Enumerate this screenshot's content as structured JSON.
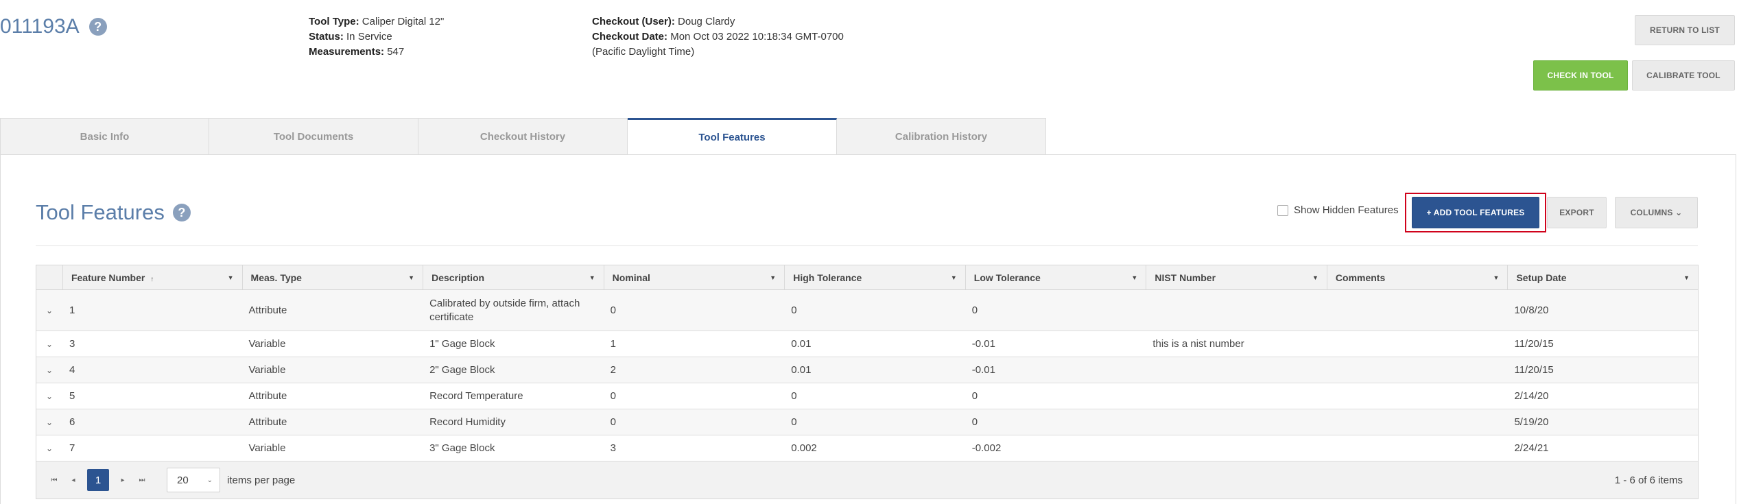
{
  "header": {
    "tool_id": "011193A",
    "help_icon": "?",
    "tool_type_label": "Tool Type:",
    "tool_type": "Caliper Digital 12\"",
    "status_label": "Status:",
    "status": "In Service",
    "measurements_label": "Measurements:",
    "measurements": "547",
    "checkout_user_label": "Checkout (User):",
    "checkout_user": "Doug Clardy",
    "checkout_date_label": "Checkout Date:",
    "checkout_date": "Mon Oct 03 2022 10:18:34 GMT-0700",
    "checkout_tz": "(Pacific Daylight Time)"
  },
  "actions": {
    "return_to_list": "RETURN TO LIST",
    "check_in_tool": "CHECK IN TOOL",
    "calibrate_tool": "CALIBRATE TOOL"
  },
  "tabs": [
    {
      "label": "Basic Info"
    },
    {
      "label": "Tool Documents"
    },
    {
      "label": "Checkout History"
    },
    {
      "label": "Tool Features"
    },
    {
      "label": "Calibration History"
    }
  ],
  "section": {
    "title": "Tool Features",
    "help_icon": "?",
    "show_hidden_label": "Show Hidden Features",
    "add_button": "+ ADD TOOL FEATURES",
    "export_button": "EXPORT",
    "columns_button": "COLUMNS ⌄"
  },
  "grid": {
    "headers": [
      "Feature Number",
      "Meas. Type",
      "Description",
      "Nominal",
      "High Tolerance",
      "Low Tolerance",
      "NIST Number",
      "Comments",
      "Setup Date"
    ],
    "sort_indicator": "↑",
    "rows": [
      [
        "1",
        "Attribute",
        "Calibrated by outside firm, attach certificate",
        "0",
        "0",
        "0",
        "",
        "",
        "10/8/20"
      ],
      [
        "3",
        "Variable",
        "1\" Gage Block",
        "1",
        "0.01",
        "-0.01",
        "this is a nist number",
        "",
        "11/20/15"
      ],
      [
        "4",
        "Variable",
        "2\" Gage Block",
        "2",
        "0.01",
        "-0.01",
        "",
        "",
        "11/20/15"
      ],
      [
        "5",
        "Attribute",
        "Record Temperature",
        "0",
        "0",
        "0",
        "",
        "",
        "2/14/20"
      ],
      [
        "6",
        "Attribute",
        "Record Humidity",
        "0",
        "0",
        "0",
        "",
        "",
        "5/19/20"
      ],
      [
        "7",
        "Variable",
        "3\" Gage Block",
        "3",
        "0.002",
        "-0.002",
        "",
        "",
        "2/24/21"
      ]
    ]
  },
  "pager": {
    "current_page": "1",
    "page_size": "20",
    "items_per_page_label": "items per page",
    "info": "1 - 6 of 6 items"
  },
  "colors": {
    "accent_blue": "#2c5491",
    "title_blue": "#5b7ea9",
    "green": "#7cc14a",
    "highlight_red": "#d0021b"
  }
}
